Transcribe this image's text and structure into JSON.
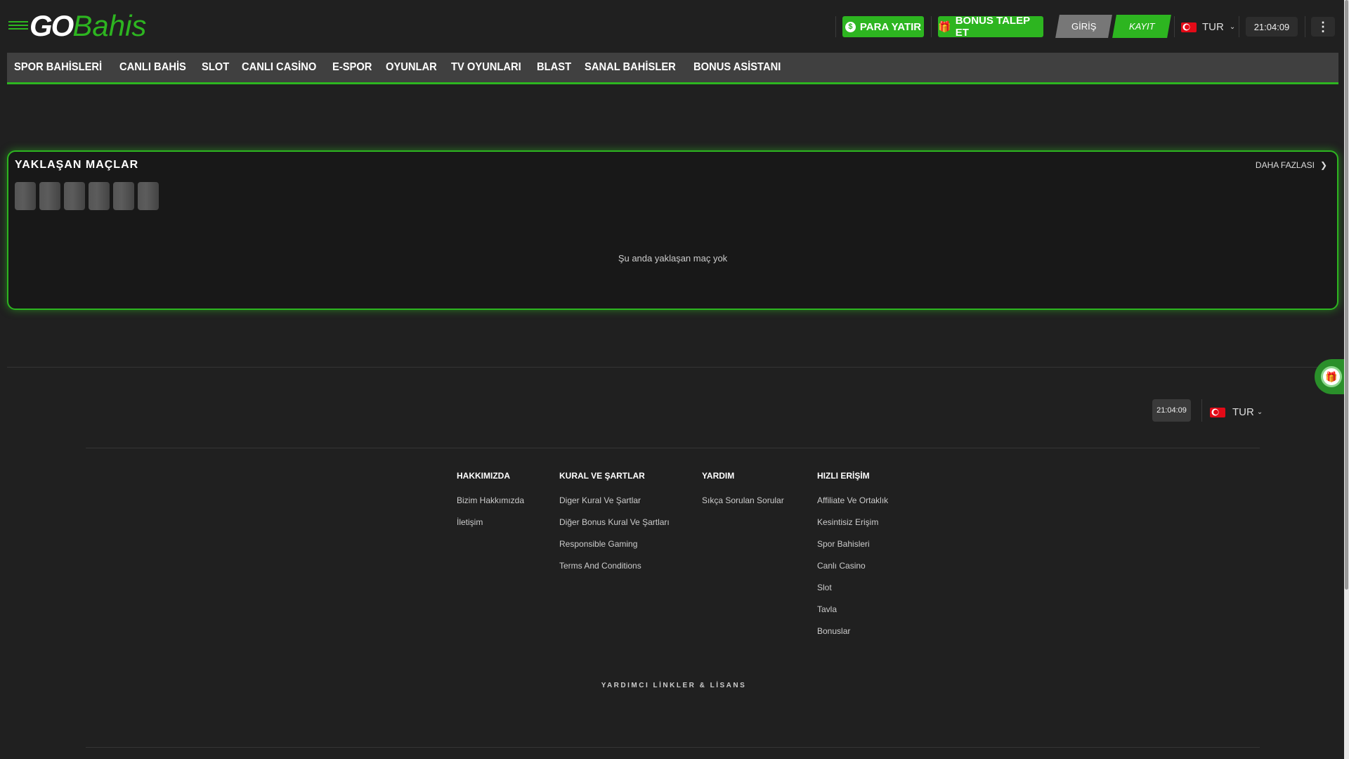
{
  "header": {
    "logo_go": "GO",
    "logo_bahis": "Bahis",
    "deposit": "PARA YATIR",
    "bonus": "BONUS TALEP ET",
    "login": "GİRİŞ",
    "register": "KAYIT",
    "lang": "TUR",
    "time": "21:04:09"
  },
  "nav": [
    "SPOR BAHİSLERİ",
    "CANLI BAHİS",
    "SLOT",
    "CANLI CASİNO",
    "E-SPOR",
    "OYUNLAR",
    "TV OYUNLARI",
    "BLAST",
    "SANAL BAHİSLER",
    "BONUS ASİSTANI"
  ],
  "matches": {
    "title": "YAKLAŞAN MAÇLAR",
    "more": "DAHA FAZLASI",
    "empty": "Şu anda yaklaşan maç yok"
  },
  "footer": {
    "time": "21:04:09",
    "lang": "TUR",
    "columns": [
      {
        "title": "HAKKIMIZDA",
        "links": [
          "Bizim Hakkımızda",
          "İletişim"
        ]
      },
      {
        "title": "KURAL VE ŞARTLAR",
        "links": [
          "Diger Kural Ve Şartlar",
          "Diğer Bonus Kural Ve Şartları",
          "Responsible Gaming",
          "Terms And Conditions"
        ]
      },
      {
        "title": "YARDIM",
        "links": [
          "Sıkça Sorulan Sorular"
        ]
      },
      {
        "title": "HIZLI ERİŞİM",
        "links": [
          "Affiliate Ve Ortaklık",
          "Kesintisiz Erişim",
          "Spor Bahisleri",
          "Canlı Casino",
          "Slot",
          "Tavla",
          "Bonuslar"
        ]
      }
    ],
    "license": "YARDIMCI LİNKLER & LİSANS"
  },
  "colors": {
    "accent": "#2db520",
    "bg": "#202020"
  }
}
